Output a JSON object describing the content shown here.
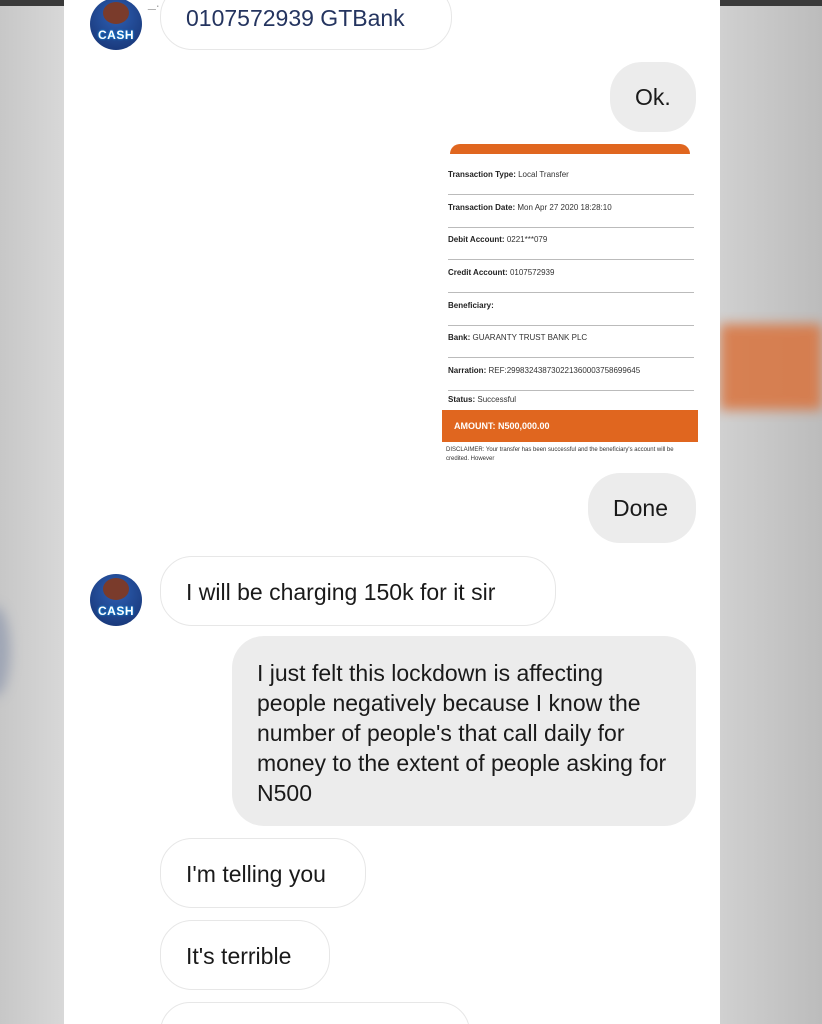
{
  "top_message": "0107572939 GTBank",
  "header_partial": "_.",
  "avatar_text": "CASH",
  "messages": {
    "ok": "Ok.",
    "done": "Done",
    "charge": "I will be charging 150k for it sir",
    "lockdown": "I just felt this lockdown is affecting people negatively because I know the number of people's that call daily for money to the extent of people asking for N500",
    "telling": "I'm telling you",
    "terrible": "It's terrible"
  },
  "receipt": {
    "type_label": "Transaction Type:",
    "type_value": "Local Transfer",
    "date_label": "Transaction Date:",
    "date_value": "Mon Apr 27 2020 18:28:10",
    "debit_label": "Debit Account:",
    "debit_value": "0221***079",
    "credit_label": "Credit Account:",
    "credit_value": "0107572939",
    "beneficiary_label": "Beneficiary:",
    "bank_label": "Bank:",
    "bank_value": "GUARANTY TRUST BANK PLC",
    "narration_label": "Narration:",
    "narration_value": "REF:299832438730221360003758699645",
    "status_label": "Status:",
    "status_value": "Successful",
    "amount_label": "AMOUNT:",
    "amount_value": "N500,000.00",
    "disclaimer": "DISCLAIMER: Your transfer has been successful and the beneficiary's account will be credited. However"
  },
  "colors": {
    "accent": "#e0661f",
    "bubble_out": "#ececec"
  }
}
